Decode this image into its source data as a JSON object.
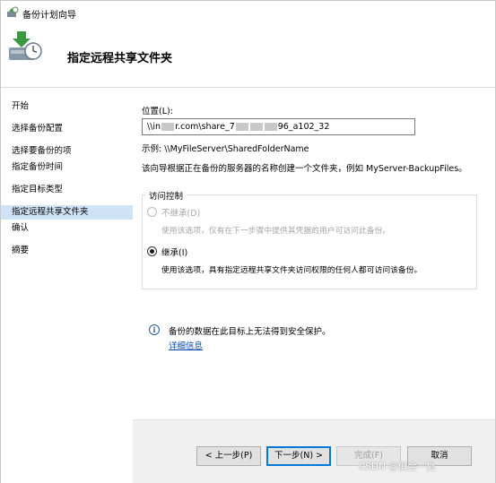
{
  "window": {
    "title": "备份计划向导",
    "header_title": "指定远程共享文件夹"
  },
  "sidebar": {
    "items": [
      {
        "label": "开始",
        "active": false
      },
      {
        "label": "选择备份配置",
        "active": false
      },
      {
        "label": "选择要备份的项",
        "active": false
      },
      {
        "label": "指定备份时间",
        "active": false
      },
      {
        "label": "指定目标类型",
        "active": false
      },
      {
        "label": "指定远程共享文件夹",
        "active": true
      },
      {
        "label": "确认",
        "active": false
      },
      {
        "label": "摘要",
        "active": false
      }
    ]
  },
  "main": {
    "location_label": "位置(L):",
    "location_value_prefix": "\\\\in",
    "location_value_mid": "r.com\\share_7",
    "location_value_suffix": "96_a102_32",
    "example_text": "示例: \\\\MyFileServer\\SharedFolderName",
    "description": "该向导根据正在备份的服务器的名称创建一个文件夹，例如 MyServer-BackupFiles。",
    "access_control": {
      "legend": "访问控制",
      "options": [
        {
          "label": "不继承(D)",
          "description": "使用该选项，仅有在下一步骤中提供其凭据的用户可访问此备份。",
          "selected": false,
          "enabled": false
        },
        {
          "label": "继承(I)",
          "description": "使用该选项，具有指定远程共享文件夹访问权限的任何人都可访问该备份。",
          "selected": true,
          "enabled": true
        }
      ]
    },
    "info_text": "备份的数据在此目标上无法得到安全保护。",
    "info_link": "详细信息"
  },
  "footer": {
    "back_label": "< 上一步(P)",
    "next_label": "下一步(N) >",
    "finish_label": "完成(F)",
    "cancel_label": "取消"
  },
  "watermark": "CSDN @俱会一处",
  "colors": {
    "active_nav_bg": "#cfe3f6",
    "link": "#0645ad",
    "default_button_border": "#0078d7"
  }
}
